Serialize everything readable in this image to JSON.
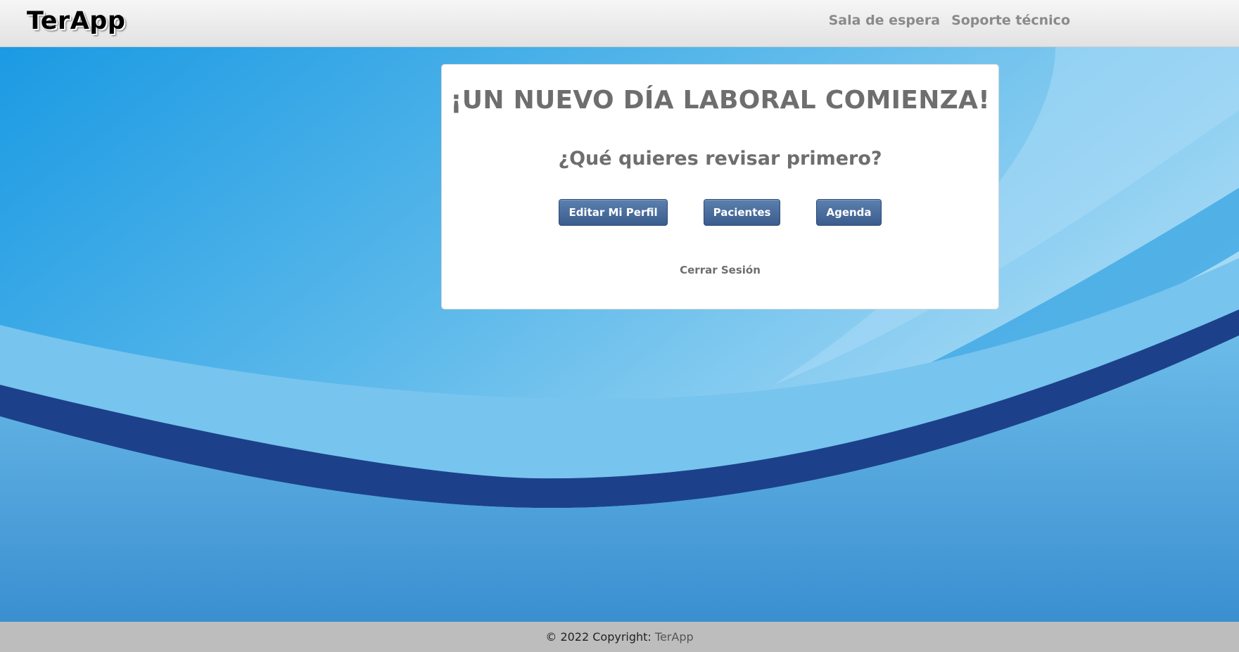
{
  "header": {
    "brand": "TerApp",
    "nav": [
      {
        "label": "Sala de espera"
      },
      {
        "label": "Soporte técnico"
      }
    ]
  },
  "card": {
    "title": "¡UN NUEVO DÍA LABORAL COMIENZA!",
    "subtitle": "¿Qué quieres revisar primero?",
    "buttons": [
      {
        "label": "Editar Mi Perfil"
      },
      {
        "label": "Pacientes"
      },
      {
        "label": "Agenda"
      }
    ],
    "logout_label": "Cerrar Sesión"
  },
  "footer": {
    "copyright": "© 2022 Copyright: ",
    "link": "TerApp"
  },
  "colors": {
    "button": "#3b5d8d",
    "text_gray": "#6e6e6e",
    "band_dark": "#1c418a",
    "sky": "#7cc6ee",
    "footer_bg": "#bdbdbd"
  }
}
